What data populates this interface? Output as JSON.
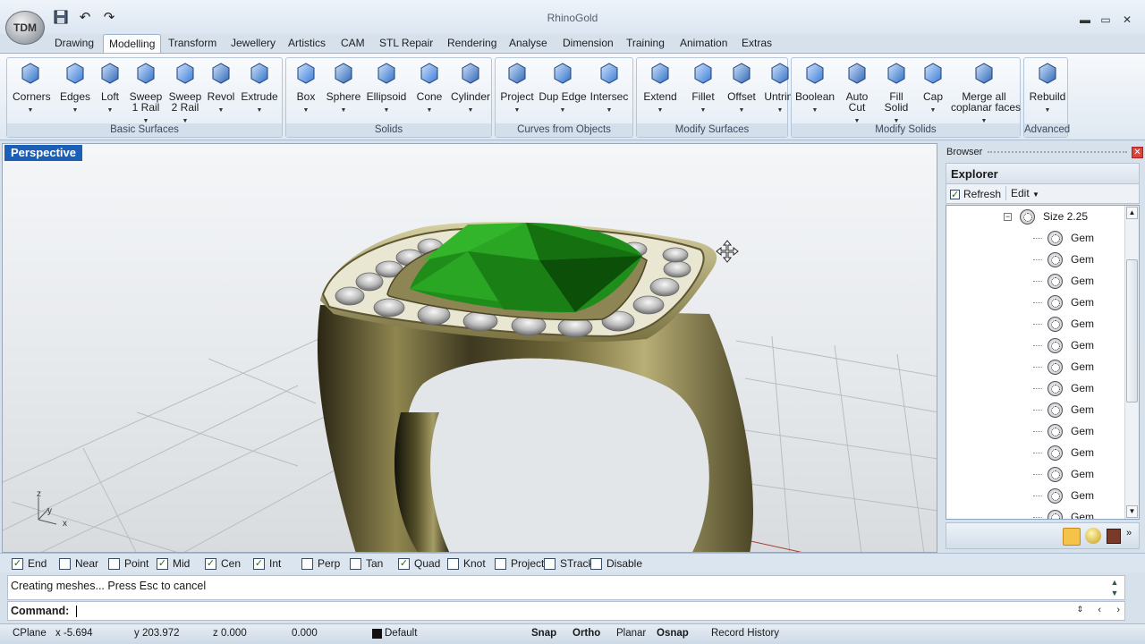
{
  "window": {
    "title": "RhinoGold",
    "logo_text": "TDM"
  },
  "quick_access": {
    "save_icon": "save-icon",
    "undo_icon": "undo-icon",
    "redo_icon": "redo-icon"
  },
  "ribbon_tabs": [
    "Drawing",
    "Modelling",
    "Transform",
    "Jewellery",
    "Artistics",
    "CAM",
    "STL Repair",
    "Rendering",
    "Analyse",
    "Dimension",
    "Training",
    "Animation",
    "Extras"
  ],
  "active_tab": "Modelling",
  "ribbon_groups": [
    {
      "label": "Basic Surfaces",
      "buttons": [
        "Corners",
        "Edges",
        "Loft",
        "Sweep\n1 Rail",
        "Sweep\n2 Rail",
        "Revol",
        "Extrude"
      ]
    },
    {
      "label": "Solids",
      "buttons": [
        "Box",
        "Sphere",
        "Ellipsoid",
        "Cone",
        "Cylinder"
      ]
    },
    {
      "label": "Curves from Objects",
      "buttons": [
        "Project",
        "Dup Edge",
        "Intersec"
      ]
    },
    {
      "label": "Modify Surfaces",
      "buttons": [
        "Extend",
        "Fillet",
        "Offset",
        "Untrim"
      ]
    },
    {
      "label": "Modify Solids",
      "buttons": [
        "Boolean",
        "Auto\nCut",
        "Fill\nSolid",
        "Cap",
        "Merge all\ncoplanar faces"
      ]
    },
    {
      "label": "Advanced",
      "buttons": [
        "Rebuild"
      ]
    }
  ],
  "viewport": {
    "label": "Perspective",
    "axes": {
      "z": "z",
      "y": "y",
      "x": "x"
    }
  },
  "browser": {
    "panel_title": "Browser",
    "explorer_title": "Explorer",
    "refresh_label": "Refresh",
    "edit_label": "Edit",
    "tree_parent": "Size 2.25",
    "tree_items": [
      "Gem",
      "Gem",
      "Gem",
      "Gem",
      "Gem",
      "Gem",
      "Gem",
      "Gem",
      "Gem",
      "Gem",
      "Gem",
      "Gem",
      "Gem",
      "Gem"
    ]
  },
  "osnaps": [
    {
      "label": "End",
      "checked": true
    },
    {
      "label": "Near",
      "checked": false
    },
    {
      "label": "Point",
      "checked": false
    },
    {
      "label": "Mid",
      "checked": true
    },
    {
      "label": "Cen",
      "checked": true
    },
    {
      "label": "Int",
      "checked": true
    },
    {
      "label": "Perp",
      "checked": false
    },
    {
      "label": "Tan",
      "checked": false
    },
    {
      "label": "Quad",
      "checked": true
    },
    {
      "label": "Knot",
      "checked": false
    },
    {
      "label": "Project",
      "checked": false
    },
    {
      "label": "STrack",
      "checked": false
    },
    {
      "label": "Disable",
      "checked": false
    }
  ],
  "command": {
    "history": "Creating meshes... Press Esc to cancel",
    "prompt": "Command:"
  },
  "status": {
    "cplane": "CPlane",
    "x": "x -5.694",
    "y": "y 203.972",
    "z": "z 0.000",
    "value": "0.000",
    "layer": "Default",
    "snap": "Snap",
    "ortho": "Ortho",
    "planar": "Planar",
    "osnap": "Osnap",
    "record_history": "Record History"
  },
  "colors": {
    "accent": "#1b5fb6",
    "gem": "#1f8d1a",
    "metal": "#6b6233"
  }
}
